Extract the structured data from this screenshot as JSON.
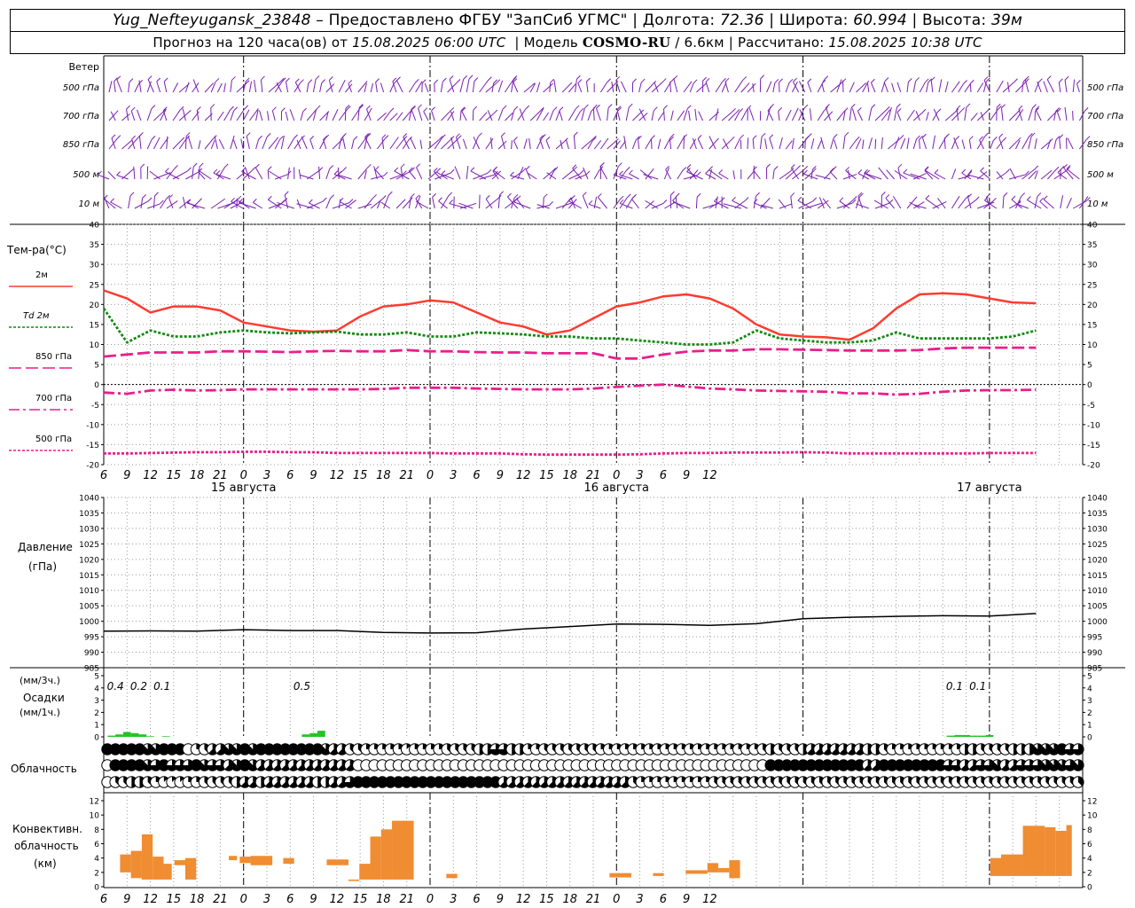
{
  "header": {
    "station": "Yug_Nefteyugansk_23848",
    "provider": " – Предоставлено ФГБУ \"ЗапСиб УГМС\" | Долгота: ",
    "lon": "72.36",
    "lat_label": " | Широта: ",
    "lat": "60.994",
    "alt_label": " | Высота: ",
    "alt": "39м",
    "forecast_prefix": "Прогноз на 120 часа(ов) от ",
    "forecast_time": "15.08.2025 06:00 UTC",
    "model_prefix": "  | Модель ",
    "model": "COSMO-RU",
    "model_res": " / 6.6км | Рассчитано: ",
    "computed": "15.08.2025 10:38 UTC"
  },
  "chart_data": [
    {
      "type": "barbs",
      "panel": "wind",
      "title": "Ветер",
      "levels": [
        "500 гПа",
        "700 гПа",
        "850 гПа",
        "500 м",
        "10  м"
      ]
    },
    {
      "type": "line",
      "panel": "temperature",
      "ylabel": "Тем-ра(°С)",
      "ylim": [
        -20,
        40
      ],
      "y_ticks": [
        -20,
        -15,
        -10,
        -5,
        0,
        5,
        10,
        15,
        20,
        25,
        30,
        35,
        40
      ],
      "x_unit": "hours since 15.08.2025 06:00 UTC",
      "x": [
        0,
        3,
        6,
        9,
        12,
        15,
        18,
        21,
        24,
        27,
        30,
        33,
        36,
        39,
        42,
        45,
        48,
        51,
        54,
        57,
        60,
        63,
        66,
        69,
        72,
        75,
        78,
        81,
        84,
        87,
        90,
        93,
        96,
        99,
        102,
        105,
        108,
        111,
        114,
        117,
        120
      ],
      "series": [
        {
          "name": "2м",
          "color": "#ff3b30",
          "style": "solid",
          "values": [
            23.5,
            21.5,
            18,
            19.5,
            19.5,
            18.5,
            15.5,
            14.5,
            13.5,
            13.2,
            13.5,
            17,
            19.5,
            20,
            21,
            20.5,
            18,
            15.5,
            14.5,
            12.5,
            13.5,
            16.5,
            19.5,
            20.5,
            22,
            22.5,
            21.5,
            19,
            15,
            12.5,
            12,
            11.8,
            11.2,
            14,
            19,
            22.5,
            22.8,
            22.5,
            21.5,
            20.5,
            20.3
          ]
        },
        {
          "name": "Td 2м",
          "color": "#138a13",
          "style": "dotted",
          "values": [
            19,
            10.5,
            13.5,
            12,
            12,
            13,
            13.5,
            13,
            12.8,
            13,
            13.2,
            12.5,
            12.5,
            13,
            12,
            12,
            13,
            12.8,
            12.5,
            12,
            12,
            11.5,
            11.5,
            11,
            10.5,
            10,
            10,
            10.5,
            13.5,
            11.5,
            11,
            10.5,
            10.5,
            11,
            13,
            11.5,
            11.5,
            11.5,
            11.5,
            12,
            13.5
          ]
        },
        {
          "name": "850 гПа",
          "color": "#e81f8c",
          "style": "longdash",
          "values": [
            7,
            7.5,
            8,
            8,
            8,
            8.3,
            8.3,
            8.2,
            8.1,
            8.3,
            8.4,
            8.3,
            8.3,
            8.6,
            8.3,
            8.3,
            8.1,
            8,
            8,
            7.8,
            7.8,
            7.8,
            6.5,
            6.5,
            7.5,
            8.2,
            8.5,
            8.5,
            8.8,
            8.8,
            8.7,
            8.6,
            8.5,
            8.5,
            8.5,
            8.6,
            9,
            9.2,
            9.2,
            9.2,
            9.2
          ]
        },
        {
          "name": "700 гПа",
          "color": "#e81f8c",
          "style": "dashdot",
          "values": [
            -2,
            -2.3,
            -1.5,
            -1.3,
            -1.5,
            -1.4,
            -1.2,
            -1.2,
            -1.2,
            -1.2,
            -1.2,
            -1.2,
            -1.1,
            -0.8,
            -0.8,
            -0.8,
            -1,
            -1.1,
            -1.2,
            -1.2,
            -1.2,
            -1,
            -0.6,
            -0.3,
            0,
            -0.5,
            -1,
            -1.2,
            -1.5,
            -1.6,
            -1.7,
            -1.8,
            -2.2,
            -2.2,
            -2.5,
            -2.3,
            -1.8,
            -1.5,
            -1.4,
            -1.4,
            -1.3
          ]
        },
        {
          "name": "500 гПа",
          "color": "#e81f8c",
          "style": "dotted",
          "values": [
            -17.2,
            -17.2,
            -17.1,
            -17,
            -16.9,
            -16.9,
            -16.8,
            -16.8,
            -16.9,
            -16.9,
            -17.1,
            -17.1,
            -17.1,
            -17.1,
            -17.1,
            -17.2,
            -17.2,
            -17.2,
            -17.4,
            -17.5,
            -17.5,
            -17.5,
            -17.5,
            -17.4,
            -17.2,
            -17.1,
            -17.1,
            -17,
            -17,
            -17,
            -16.9,
            -17,
            -17.2,
            -17.2,
            -17.2,
            -17.2,
            -17.2,
            -17.2,
            -17.1,
            -17.1,
            -17.1
          ]
        }
      ],
      "x_tick_labels": [
        "6",
        "9",
        "12",
        "15",
        "18",
        "21",
        "0",
        "3",
        "6",
        "9",
        "12",
        "15",
        "18",
        "21",
        "0",
        "3",
        "6",
        "9",
        "12",
        "15",
        "18",
        "21",
        "0",
        "3",
        "6",
        "9",
        "12"
      ],
      "date_labels": [
        "15 августа",
        "16 августа",
        "17 августа"
      ]
    },
    {
      "type": "line",
      "panel": "pressure",
      "ylabel": "Давление",
      "ylabel2": "(гПа)",
      "ylim": [
        985,
        1040
      ],
      "y_ticks": [
        985,
        990,
        995,
        1000,
        1005,
        1010,
        1015,
        1020,
        1025,
        1030,
        1035,
        1040
      ],
      "x": [
        0,
        6,
        12,
        18,
        24,
        30,
        36,
        42,
        48,
        54,
        60,
        66,
        72,
        78,
        84,
        90,
        96,
        102,
        108,
        114,
        120
      ],
      "series": [
        {
          "name": "Давление",
          "color": "#000000",
          "values": [
            996.8,
            996.9,
            996.8,
            997.3,
            997.0,
            997.0,
            996.4,
            996.2,
            996.3,
            997.5,
            998.3,
            999.1,
            999.0,
            998.7,
            999.2,
            1000.8,
            1001.3,
            1001.6,
            1001.8,
            1001.7,
            1002.5
          ]
        }
      ]
    },
    {
      "type": "bar",
      "panel": "precipitation",
      "ylabel": "(мм/3ч.)",
      "ylabel2": "Осадки",
      "ylabel3": "(мм/1ч.)",
      "ylim": [
        0,
        5
      ],
      "y_ticks": [
        0,
        1,
        2,
        3,
        4,
        5
      ],
      "color": "#22c522",
      "x": [
        1,
        2,
        3,
        4,
        5,
        6,
        8,
        26,
        27,
        28,
        109,
        110,
        111,
        112,
        113,
        114
      ],
      "values": [
        0.1,
        0.2,
        0.4,
        0.3,
        0.2,
        0.05,
        0.05,
        0.2,
        0.3,
        0.5,
        0.1,
        0.15,
        0.15,
        0.1,
        0.1,
        0.15
      ],
      "totals": [
        {
          "x": 1.5,
          "label": "0.4"
        },
        {
          "x": 4.5,
          "label": "0.2"
        },
        {
          "x": 7.5,
          "label": "0.1"
        },
        {
          "x": 25.5,
          "label": "0.5"
        },
        {
          "x": 109.5,
          "label": "0.1"
        },
        {
          "x": 112.5,
          "label": "0.1"
        }
      ]
    },
    {
      "type": "cloud_symbols",
      "panel": "clouds",
      "ylabel": "Облачность",
      "x_step_hours": 2,
      "rows_eighths": [
        "8888877888023557787888888887553322222122223333446644223333333222222222222222222223433345555555443222222222443333444777866",
        "0888876866687665787555555555555000000000000000000000000000000000000000000000000000888888888888558888888866556675566677767",
        "0334432111223333455455555544556888888888888888888555555555555555532222222223333333333333333333333333333333333333333333333"
      ]
    },
    {
      "type": "bar",
      "panel": "convective_clouds",
      "ylabel": "Конвективн.",
      "ylabel2": "облачность",
      "ylabel3": "(км)",
      "ylim": [
        0,
        12
      ],
      "y_ticks": [
        0,
        2,
        4,
        6,
        8,
        10,
        12
      ],
      "color": "#f08c32",
      "bars": [
        {
          "x0": 3,
          "x1": 5,
          "bottom": 2,
          "top": 4.5
        },
        {
          "x0": 5,
          "x1": 7,
          "bottom": 1.2,
          "top": 5
        },
        {
          "x0": 7,
          "x1": 9,
          "bottom": 1.0,
          "top": 7.3
        },
        {
          "x0": 9,
          "x1": 11,
          "bottom": 1.0,
          "top": 4.2
        },
        {
          "x0": 11,
          "x1": 12.5,
          "bottom": 1.0,
          "top": 3.2
        },
        {
          "x0": 13,
          "x1": 15,
          "bottom": 3.0,
          "top": 3.7
        },
        {
          "x0": 15,
          "x1": 17,
          "bottom": 1.0,
          "top": 4.0
        },
        {
          "x0": 23,
          "x1": 24.5,
          "bottom": 3.7,
          "top": 4.3
        },
        {
          "x0": 25,
          "x1": 27,
          "bottom": 3.3,
          "top": 4.2
        },
        {
          "x0": 27,
          "x1": 31,
          "bottom": 3.0,
          "top": 4.3
        },
        {
          "x0": 33,
          "x1": 35,
          "bottom": 3.2,
          "top": 4.0
        },
        {
          "x0": 41,
          "x1": 45,
          "bottom": 3.0,
          "top": 3.8
        },
        {
          "x0": 45,
          "x1": 47,
          "bottom": 0.8,
          "top": 1.0
        },
        {
          "x0": 47,
          "x1": 49,
          "bottom": 1.0,
          "top": 3.2
        },
        {
          "x0": 49,
          "x1": 51,
          "bottom": 1.0,
          "top": 7.0
        },
        {
          "x0": 51,
          "x1": 53,
          "bottom": 1.0,
          "top": 8.0
        },
        {
          "x0": 53,
          "x1": 57,
          "bottom": 1.0,
          "top": 9.2
        },
        {
          "x0": 63,
          "x1": 65,
          "bottom": 1.2,
          "top": 1.8
        },
        {
          "x0": 93,
          "x1": 97,
          "bottom": 1.3,
          "top": 1.9
        },
        {
          "x0": 101,
          "x1": 103,
          "bottom": 1.5,
          "top": 1.9
        },
        {
          "x0": 107,
          "x1": 111,
          "bottom": 1.8,
          "top": 2.3
        },
        {
          "x0": 111,
          "x1": 113,
          "bottom": 2.0,
          "top": 3.3
        },
        {
          "x0": 113,
          "x1": 115,
          "bottom": 2.0,
          "top": 2.6
        },
        {
          "x0": 115,
          "x1": 117,
          "bottom": 1.2,
          "top": 3.7
        },
        {
          "x0": 163,
          "x1": 165,
          "bottom": 1.5,
          "top": 4.0
        },
        {
          "x0": 165,
          "x1": 169,
          "bottom": 1.5,
          "top": 4.5
        },
        {
          "x0": 169,
          "x1": 173,
          "bottom": 1.5,
          "top": 8.5
        },
        {
          "x0": 173,
          "x1": 175,
          "bottom": 1.5,
          "top": 8.3
        },
        {
          "x0": 175,
          "x1": 177,
          "bottom": 1.5,
          "top": 7.8
        },
        {
          "x0": 177,
          "x1": 178,
          "bottom": 1.5,
          "top": 8.6
        }
      ],
      "x_tick_labels": [
        "6",
        "9",
        "12",
        "15",
        "18",
        "21",
        "0",
        "3",
        "6",
        "9",
        "12",
        "15",
        "18",
        "21",
        "0",
        "3",
        "6",
        "9",
        "12",
        "15",
        "18",
        "21",
        "0",
        "3",
        "6",
        "9",
        "12"
      ]
    }
  ]
}
